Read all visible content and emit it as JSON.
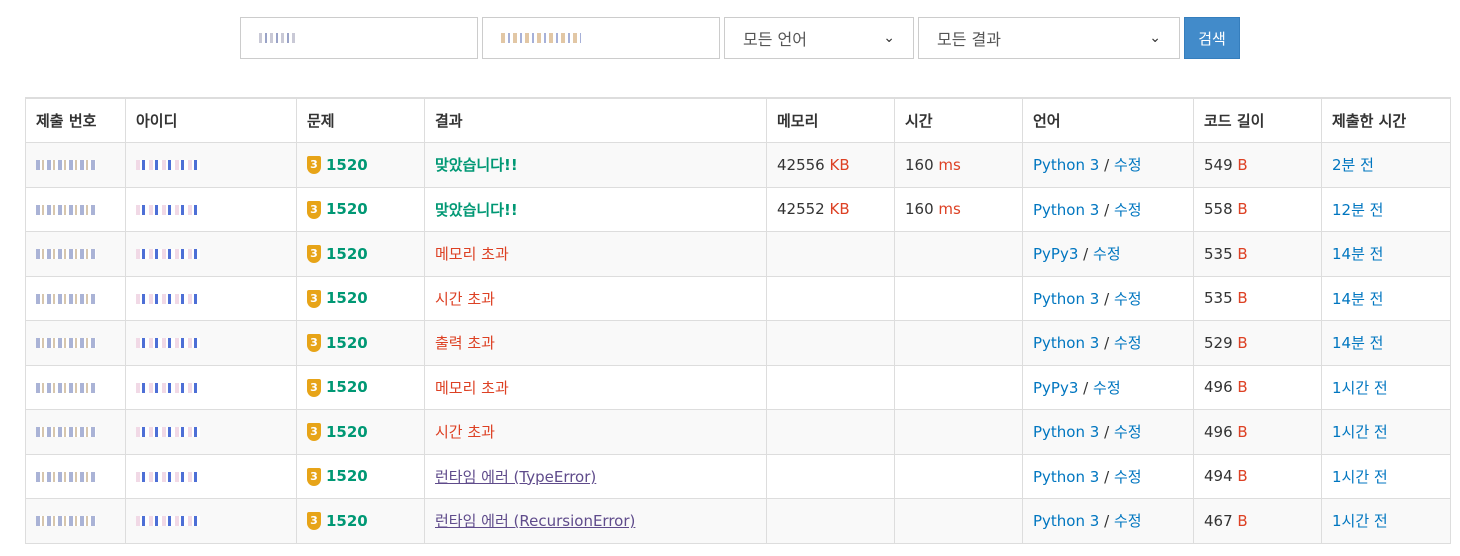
{
  "search": {
    "user_field": "",
    "problem_field": "",
    "language_select": "모든 언어",
    "result_select": "모든 결과",
    "search_button": "검색"
  },
  "table": {
    "headers": [
      "제출 번호",
      "아이디",
      "문제",
      "결과",
      "메모리",
      "시간",
      "언어",
      "코드 길이",
      "제출한 시간"
    ],
    "rows": [
      {
        "problem": "1520",
        "tier": "3",
        "result": "맞았습니다!!",
        "result_type": "ok",
        "memory": "42556",
        "memory_unit": "KB",
        "time": "160",
        "time_unit": "ms",
        "language": "Python 3",
        "edit": "수정",
        "code_length": "549",
        "code_unit": "B",
        "submitted": "2분 전"
      },
      {
        "problem": "1520",
        "tier": "3",
        "result": "맞았습니다!!",
        "result_type": "ok",
        "memory": "42552",
        "memory_unit": "KB",
        "time": "160",
        "time_unit": "ms",
        "language": "Python 3",
        "edit": "수정",
        "code_length": "558",
        "code_unit": "B",
        "submitted": "12분 전"
      },
      {
        "problem": "1520",
        "tier": "3",
        "result": "메모리 초과",
        "result_type": "err",
        "memory": "",
        "memory_unit": "",
        "time": "",
        "time_unit": "",
        "language": "PyPy3",
        "edit": "수정",
        "code_length": "535",
        "code_unit": "B",
        "submitted": "14분 전"
      },
      {
        "problem": "1520",
        "tier": "3",
        "result": "시간 초과",
        "result_type": "err",
        "memory": "",
        "memory_unit": "",
        "time": "",
        "time_unit": "",
        "language": "Python 3",
        "edit": "수정",
        "code_length": "535",
        "code_unit": "B",
        "submitted": "14분 전"
      },
      {
        "problem": "1520",
        "tier": "3",
        "result": "출력 초과",
        "result_type": "err",
        "memory": "",
        "memory_unit": "",
        "time": "",
        "time_unit": "",
        "language": "Python 3",
        "edit": "수정",
        "code_length": "529",
        "code_unit": "B",
        "submitted": "14분 전"
      },
      {
        "problem": "1520",
        "tier": "3",
        "result": "메모리 초과",
        "result_type": "err",
        "memory": "",
        "memory_unit": "",
        "time": "",
        "time_unit": "",
        "language": "PyPy3",
        "edit": "수정",
        "code_length": "496",
        "code_unit": "B",
        "submitted": "1시간 전"
      },
      {
        "problem": "1520",
        "tier": "3",
        "result": "시간 초과",
        "result_type": "err",
        "memory": "",
        "memory_unit": "",
        "time": "",
        "time_unit": "",
        "language": "Python 3",
        "edit": "수정",
        "code_length": "496",
        "code_unit": "B",
        "submitted": "1시간 전"
      },
      {
        "problem": "1520",
        "tier": "3",
        "result": "런타임 에러 (TypeError)",
        "result_type": "rte",
        "memory": "",
        "memory_unit": "",
        "time": "",
        "time_unit": "",
        "language": "Python 3",
        "edit": "수정",
        "code_length": "494",
        "code_unit": "B",
        "submitted": "1시간 전"
      },
      {
        "problem": "1520",
        "tier": "3",
        "result": "런타임 에러 (RecursionError)",
        "result_type": "rte",
        "memory": "",
        "memory_unit": "",
        "time": "",
        "time_unit": "",
        "language": "Python 3",
        "edit": "수정",
        "code_length": "467",
        "code_unit": "B",
        "submitted": "1시간 전"
      }
    ]
  }
}
